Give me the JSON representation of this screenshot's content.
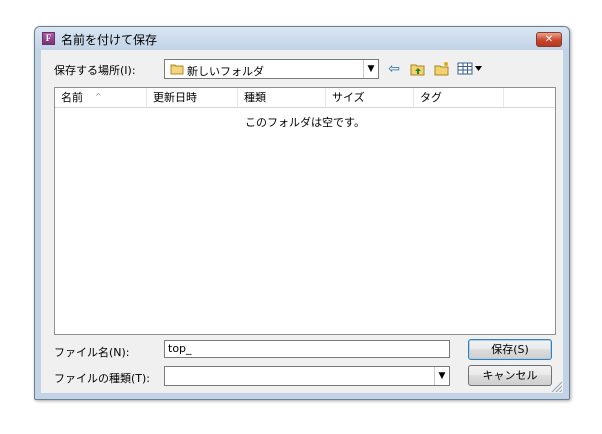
{
  "dialog": {
    "title": "名前を付けて保存",
    "app_icon_letter": "F",
    "close_symbol": "✕"
  },
  "toolbar": {
    "save_in_label": "保存する場所(I):",
    "location_value": "新しいフォルダ",
    "icons": [
      "back-arrow-icon",
      "up-folder-icon",
      "new-folder-icon",
      "view-menu-icon"
    ]
  },
  "list": {
    "columns": [
      "名前",
      "更新日時",
      "種類",
      "サイズ",
      "タグ"
    ],
    "sort_indicator": "^",
    "empty_message": "このフォルダは空です。"
  },
  "form": {
    "filename_label": "ファイル名(N):",
    "filename_value": "top_",
    "filetype_label": "ファイルの種類(T):",
    "filetype_value": "",
    "save_button": "保存(S)",
    "cancel_button": "キャンセル"
  },
  "colors": {
    "frame": "#c3d3e6",
    "client": "#f0f0f0",
    "close_button": "#c9462d",
    "toolbar_icons": "#1c6fa8"
  }
}
